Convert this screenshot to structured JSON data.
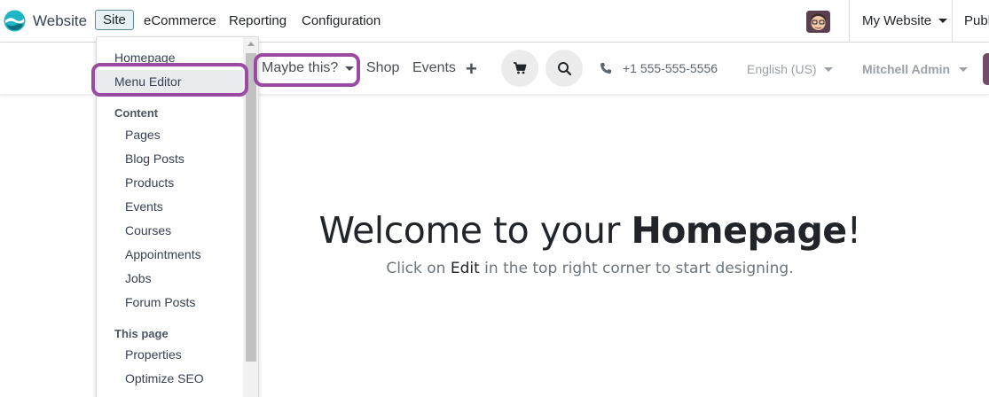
{
  "topbar": {
    "app_name": "Website",
    "menu": [
      "Site",
      "eCommerce",
      "Reporting",
      "Configuration"
    ],
    "my_website": "My Website",
    "publish_partial": "Publi"
  },
  "site_header": {
    "maybe": "Maybe this?",
    "shop": "Shop",
    "events": "Events",
    "plus": "+",
    "phone": "+1 555-555-5556",
    "language": "English (US)",
    "user": "Mitchell Admin"
  },
  "dropdown": {
    "homepage": "Homepage",
    "menu_editor": "Menu Editor",
    "content_header": "Content",
    "content_items": [
      "Pages",
      "Blog Posts",
      "Products",
      "Events",
      "Courses",
      "Appointments",
      "Jobs",
      "Forum Posts"
    ],
    "this_page_header": "This page",
    "this_page_items": [
      "Properties",
      "Optimize SEO"
    ]
  },
  "hero": {
    "title_start": "Welcome to your ",
    "title_bold": "Homepage",
    "title_end": "!",
    "sub_start": "Click on ",
    "sub_edit": "Edit",
    "sub_end": " in the top right corner to start designing."
  },
  "colors": {
    "highlight": "#9b4aa1",
    "brand": "#714b67",
    "site_active_border": "#5c8795"
  },
  "icons": [
    "website-logo-icon",
    "cart-icon",
    "search-icon",
    "phone-icon",
    "caret-down-icon",
    "plus-icon"
  ]
}
